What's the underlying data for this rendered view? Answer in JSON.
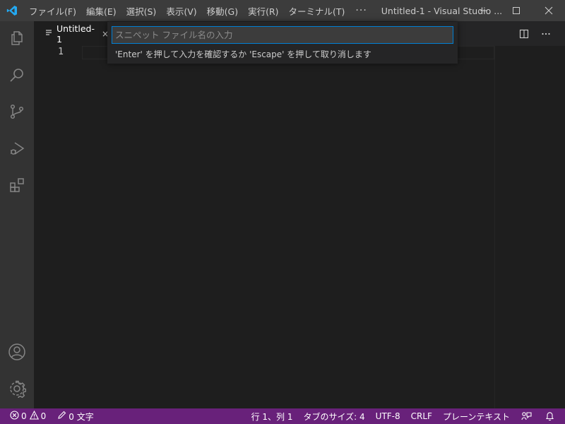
{
  "colors": {
    "titlebar_bg": "#3c3c3c",
    "activitybar_bg": "#333333",
    "editor_bg": "#1e1e1e",
    "statusbar_bg": "#68217a",
    "input_focus_border": "#007fd4",
    "vscode_blue": "#23a9f2"
  },
  "titlebar": {
    "menus": [
      "ファイル(F)",
      "編集(E)",
      "選択(S)",
      "表示(V)",
      "移動(G)",
      "実行(R)",
      "ターミナル(T)"
    ],
    "more_label": "···",
    "window_title": "Untitled-1 - Visual Studio ...",
    "logo_icon": "vscode-logo",
    "controls": [
      "minimize-icon",
      "maximize-icon",
      "close-icon"
    ]
  },
  "activitybar": {
    "items": [
      "explorer-icon",
      "search-icon",
      "source-control-icon",
      "run-debug-icon",
      "extensions-icon"
    ],
    "bottom": [
      "account-icon",
      "manage-gear-icon"
    ]
  },
  "tab": {
    "label": "Untitled-1",
    "icon": "plain-text-file-icon",
    "close": "×"
  },
  "editor": {
    "line_numbers": [
      "1"
    ]
  },
  "quick_input": {
    "placeholder": "スニペット ファイル名の入力",
    "value": "",
    "message": "'Enter' を押して入力を確認するか 'Escape' を押して取り消します"
  },
  "statusbar": {
    "errors": "0",
    "warnings": "0",
    "words": "0 文字",
    "position": "行 1、列 1",
    "tab_size": "タブのサイズ: 4",
    "encoding": "UTF-8",
    "eol": "CRLF",
    "language": "プレーンテキスト",
    "feedback_icon": "feedback-icon",
    "bell_icon": "notification-bell-icon"
  }
}
